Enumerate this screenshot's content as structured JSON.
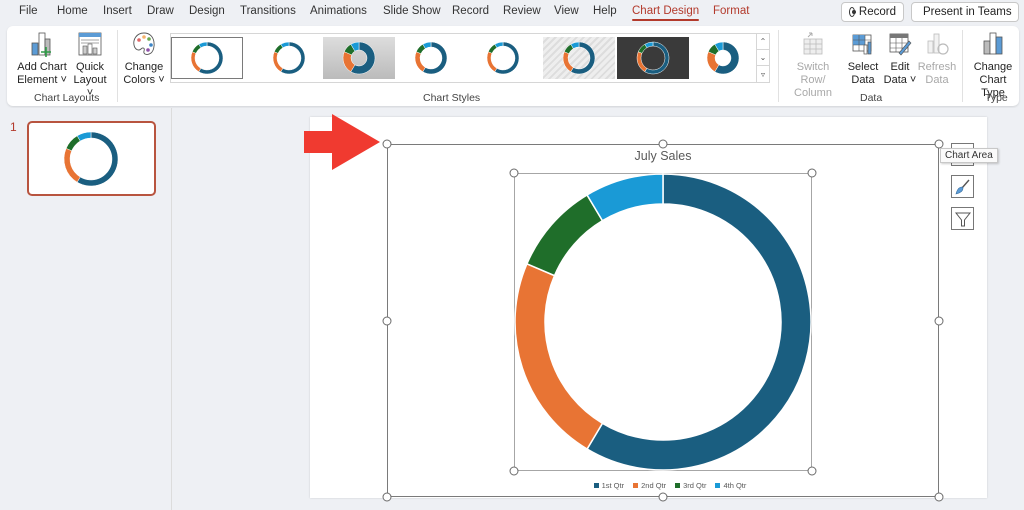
{
  "menu": {
    "tabs": [
      {
        "label": "File"
      },
      {
        "label": "Home"
      },
      {
        "label": "Insert"
      },
      {
        "label": "Draw"
      },
      {
        "label": "Design"
      },
      {
        "label": "Transitions"
      },
      {
        "label": "Animations"
      },
      {
        "label": "Slide Show"
      },
      {
        "label": "Record"
      },
      {
        "label": "Review"
      },
      {
        "label": "View"
      },
      {
        "label": "Help"
      },
      {
        "label": "Chart Design"
      },
      {
        "label": "Format"
      }
    ],
    "active_tab": "Chart Design",
    "record_button": "Record",
    "present_button": "Present in Teams"
  },
  "ribbon": {
    "chart_layouts": {
      "group_label": "Chart Layouts",
      "add_chart_element": [
        "Add Chart",
        "Element ˅"
      ],
      "quick_layout": [
        "Quick",
        "Layout ˅"
      ]
    },
    "chart_styles": {
      "group_label": "Chart Styles",
      "change_colors": [
        "Change",
        "Colors ˅"
      ],
      "styles": [
        "Style 1",
        "Style 2",
        "Style 3",
        "Style 4",
        "Style 5",
        "Style 6",
        "Style 7",
        "Style 8"
      ],
      "selected_style_index": 0
    },
    "data": {
      "group_label": "Data",
      "switch_row_column": [
        "Switch Row/",
        "Column"
      ],
      "select_data": [
        "Select",
        "Data"
      ],
      "edit_data": [
        "Edit",
        "Data ˅"
      ],
      "refresh_data": [
        "Refresh",
        "Data"
      ]
    },
    "type": {
      "group_label": "Type",
      "change_chart_type": [
        "Change",
        "Chart Type"
      ]
    }
  },
  "slides_pane": {
    "slide_number": "1"
  },
  "tooltip": "Chart Area",
  "colors": {
    "accent": "#b33a2c",
    "arrow": "#f03a30"
  },
  "chart_data": {
    "type": "pie",
    "variant": "doughnut",
    "title": "July Sales",
    "categories": [
      "1st Qtr",
      "2nd Qtr",
      "3rd Qtr",
      "4th Qtr"
    ],
    "values": [
      8.2,
      3.2,
      1.4,
      1.2
    ],
    "colors": [
      "#1a5e80",
      "#e87434",
      "#1f6e2a",
      "#1a9ad6"
    ],
    "legend": "bottom"
  }
}
